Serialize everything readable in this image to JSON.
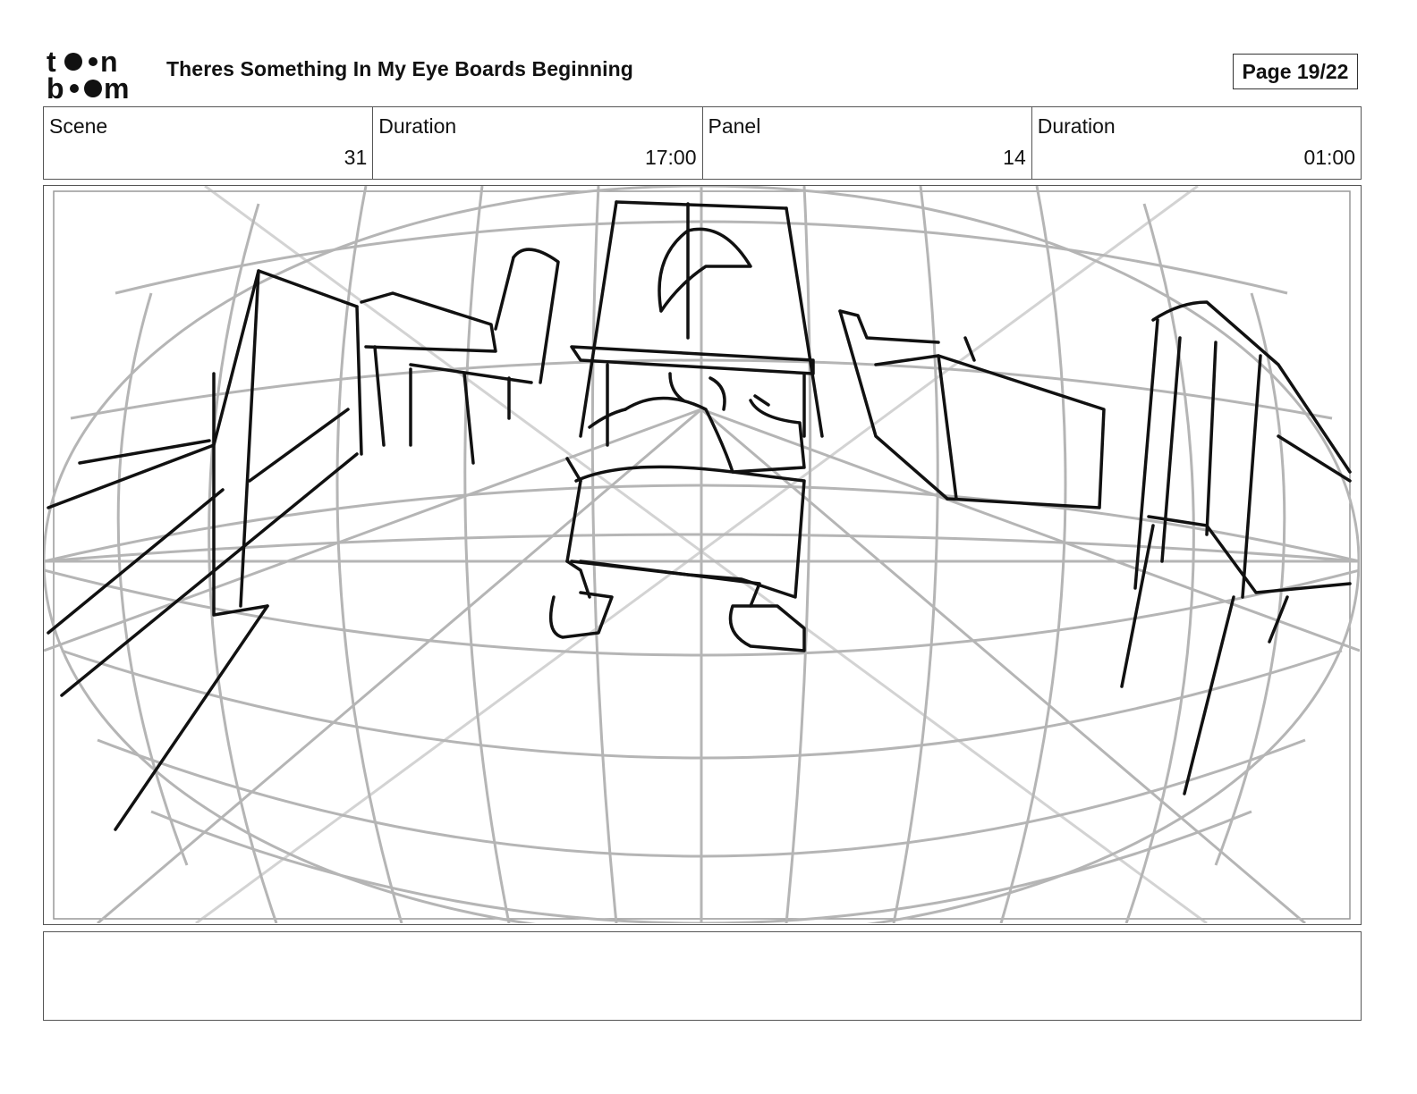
{
  "header": {
    "logo": {
      "top_text": "toon",
      "bottom_text": "boom",
      "icon": "toonboom-logo"
    },
    "title": "Theres Something In My Eye Boards Beginning",
    "page_label": "Page 19/22"
  },
  "info": {
    "scene": {
      "label": "Scene",
      "value": "31"
    },
    "scene_duration": {
      "label": "Duration",
      "value": "17:00"
    },
    "panel": {
      "label": "Panel",
      "value": "14"
    },
    "panel_duration": {
      "label": "Duration",
      "value": "01:00"
    }
  },
  "panel_image": {
    "description_icon": "fisheye-sketch-room-character-at-desk",
    "stroke_color": "#111111",
    "guide_color": "#b5b5b5"
  },
  "notes": {
    "text": ""
  }
}
